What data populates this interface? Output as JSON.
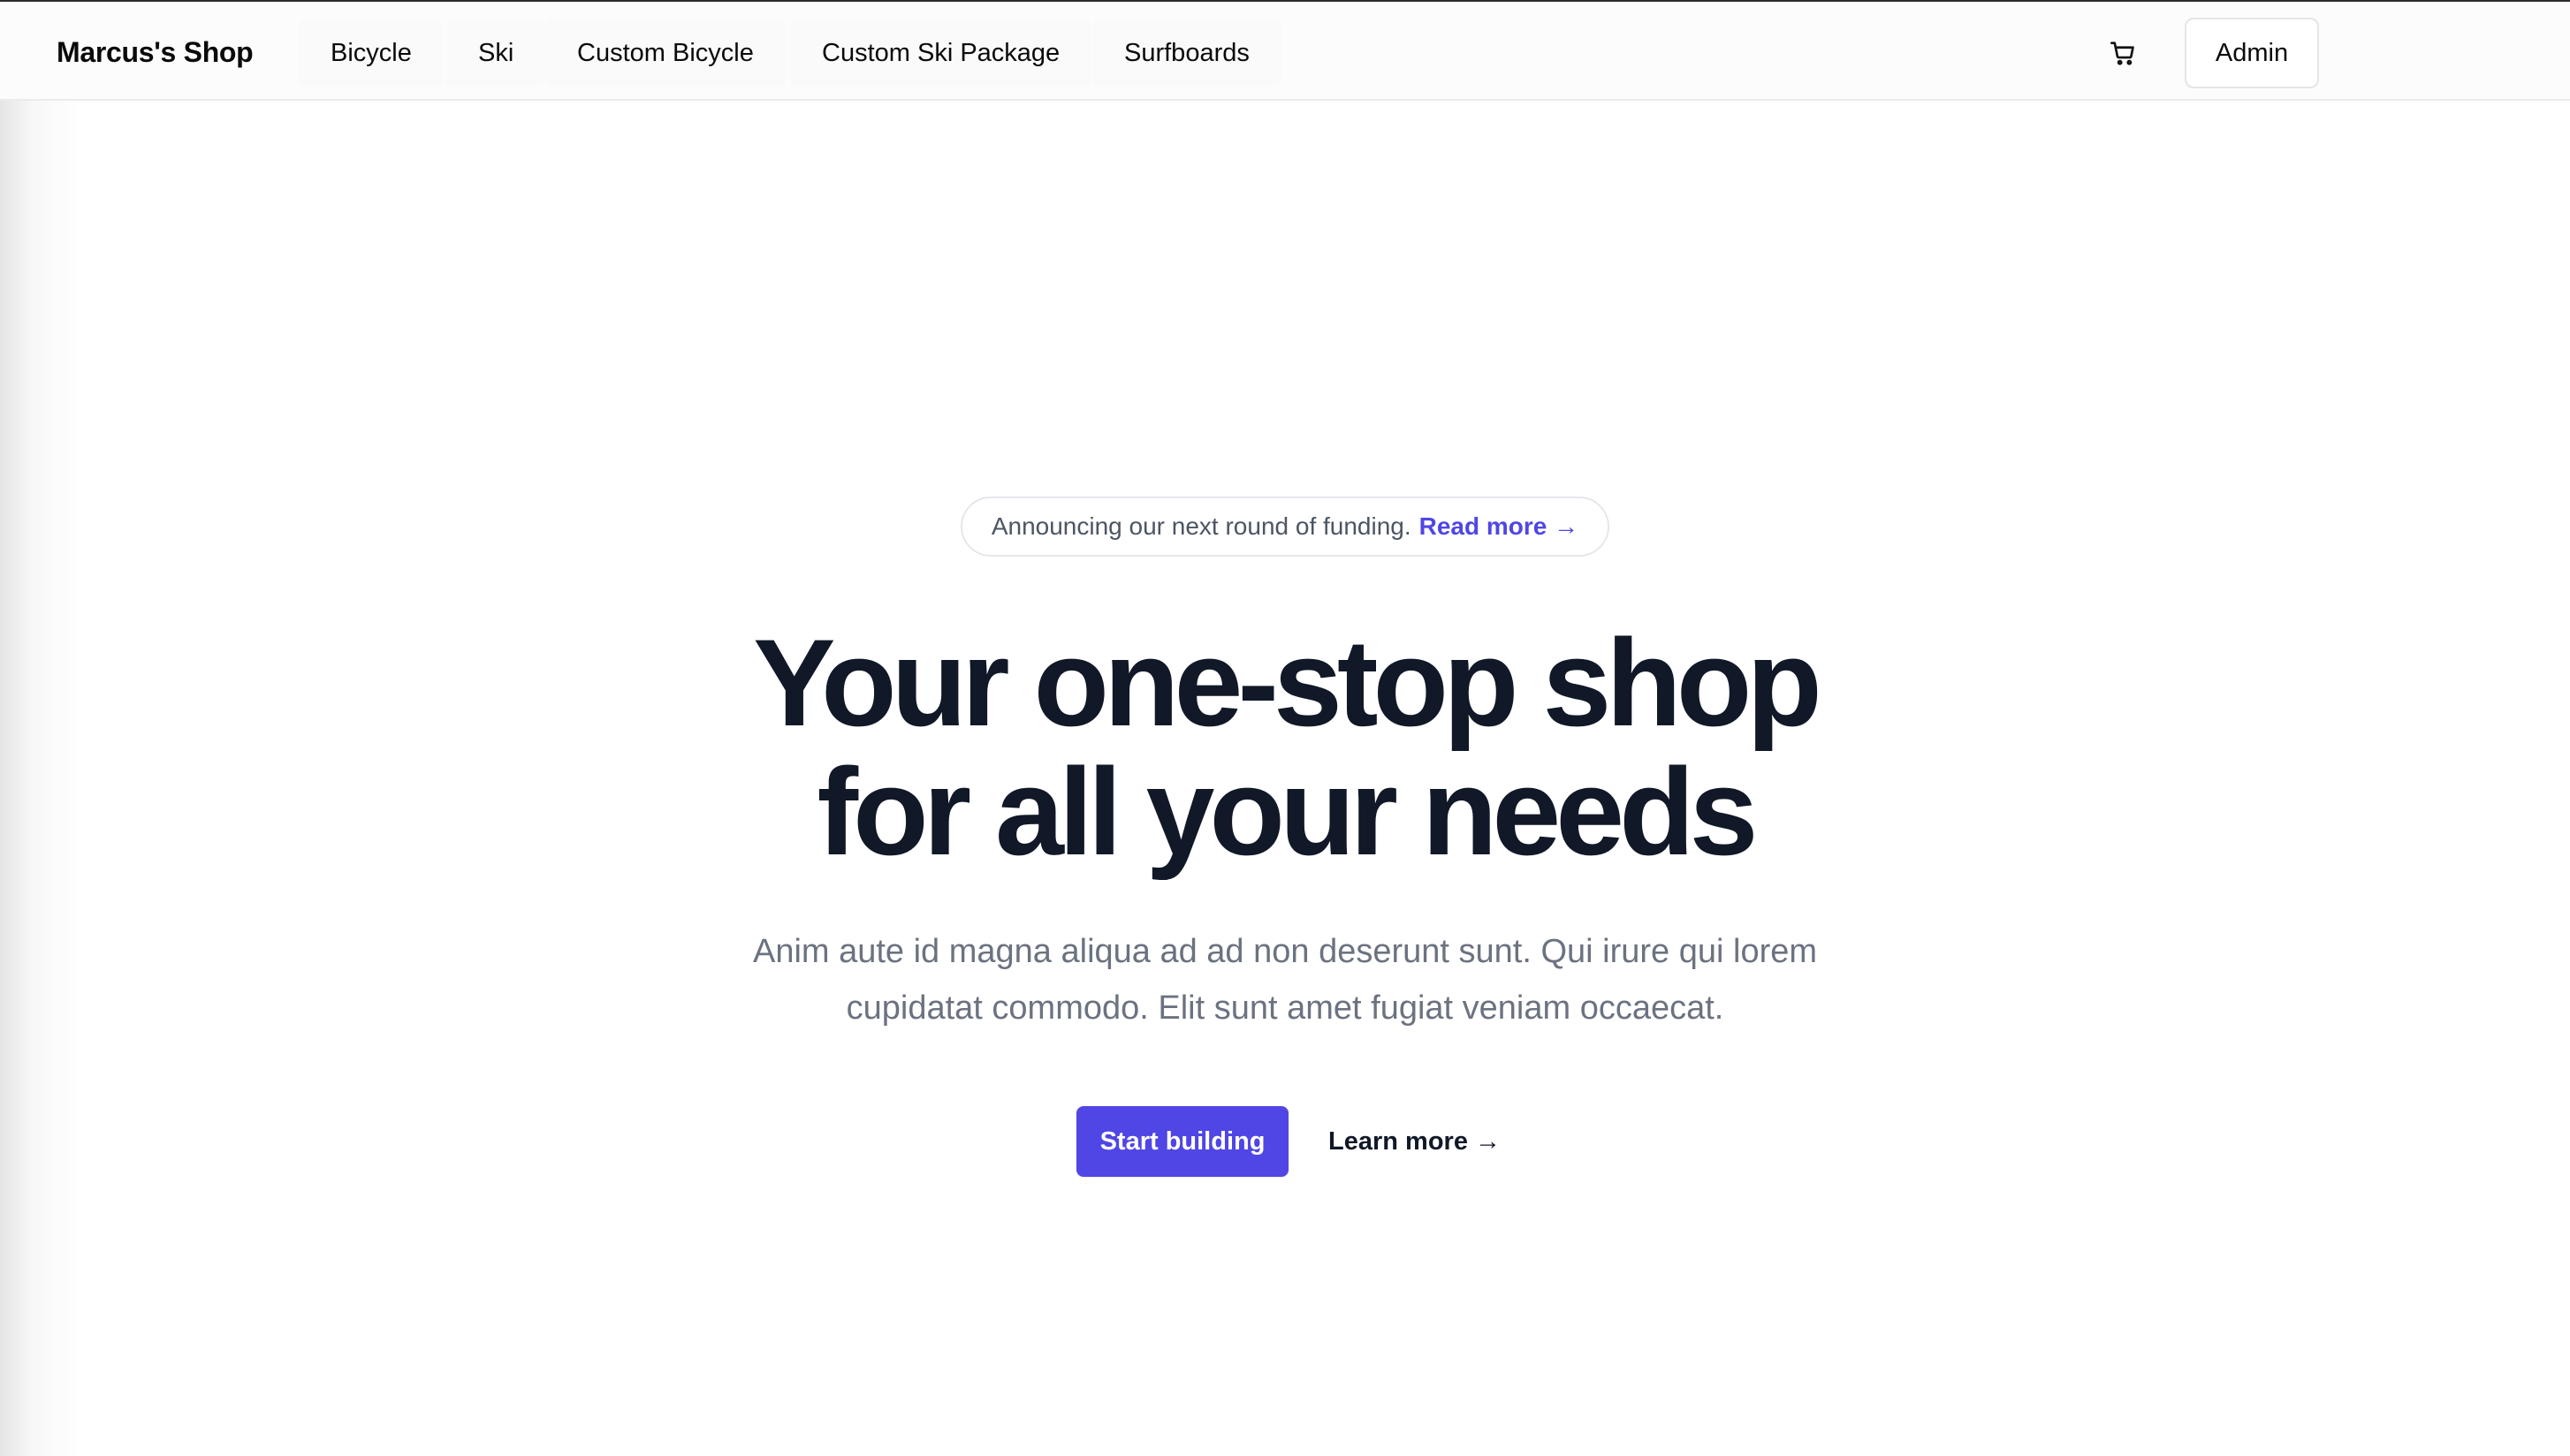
{
  "header": {
    "brand": "Marcus's Shop",
    "nav": [
      {
        "label": "Bicycle"
      },
      {
        "label": "Ski"
      },
      {
        "label": "Custom Bicycle"
      },
      {
        "label": "Custom Ski Package"
      },
      {
        "label": "Surfboards"
      }
    ],
    "cart_icon": "shopping-cart-icon",
    "admin_label": "Admin"
  },
  "hero": {
    "announcement": {
      "text": "Announcing our next round of funding.",
      "link_label": "Read more →"
    },
    "title_lines": [
      "Your one-stop shop",
      "for all your needs"
    ],
    "subtitle_lines": [
      "Anim aute id magna aliqua ad ad non deserunt sunt. Qui irure qui lorem",
      "cupidatat commodo. Elit sunt amet fugiat veniam occaecat."
    ],
    "primary_cta": "Start building",
    "secondary_cta": "Learn more →"
  },
  "colors": {
    "accent": "#4f46e5",
    "heading": "#111827",
    "muted_text": "#6b7280",
    "background": "#ffffff"
  }
}
